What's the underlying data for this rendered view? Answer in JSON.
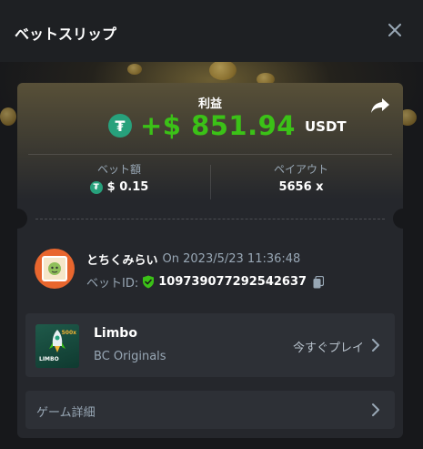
{
  "header": {
    "title": "ベットスリップ"
  },
  "profit": {
    "label": "利益",
    "value": "+$ 851.94",
    "currency": "USDT",
    "coin_symbol": "₮"
  },
  "stats": {
    "bet_amount_label": "ベット額",
    "bet_amount_value": "$ 0.15",
    "payout_label": "ペイアウト",
    "payout_value": "5656 x"
  },
  "user": {
    "name": "とちくみらい",
    "on_text": "On 2023/5/23 11:36:48",
    "bet_id_label": "ベットID:",
    "bet_id_value": "109739077292542637"
  },
  "game": {
    "title": "Limbo",
    "provider": "BC Originals",
    "play_label": "今すぐプレイ",
    "thumb_text": "LIMBO",
    "thumb_badge": "500x"
  },
  "details": {
    "label": "ゲーム詳細"
  },
  "colors": {
    "accent_green": "#3bc117",
    "tether": "#27a17c",
    "muted_text": "#98a7b5",
    "card_bg": "#25272c"
  },
  "icons": [
    "close-icon",
    "share-icon",
    "tether-icon",
    "shield-check-icon",
    "copy-icon",
    "chevron-right-icon"
  ]
}
